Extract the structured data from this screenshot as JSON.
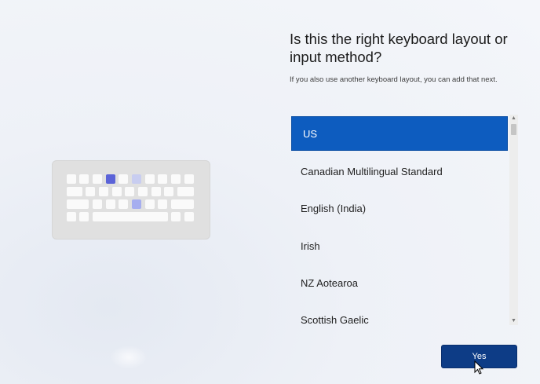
{
  "page": {
    "title": "Is this the right keyboard layout or input method?",
    "subtitle": "If you also use another keyboard layout, you can add that next."
  },
  "layouts": {
    "items": [
      {
        "label": "US",
        "selected": true
      },
      {
        "label": "Canadian Multilingual Standard",
        "selected": false
      },
      {
        "label": "English (India)",
        "selected": false
      },
      {
        "label": "Irish",
        "selected": false
      },
      {
        "label": "NZ Aotearoa",
        "selected": false
      },
      {
        "label": "Scottish Gaelic",
        "selected": false
      }
    ]
  },
  "actions": {
    "yes_label": "Yes"
  },
  "icons": {
    "illustration": "keyboard-illustration-icon",
    "scroll_up": "chevron-up-icon",
    "scroll_down": "chevron-down-icon",
    "cursor": "mouse-pointer-icon"
  },
  "colors": {
    "accent": "#0d5cbf",
    "button": "#0d3c86",
    "key_highlight": "#5b63d8"
  }
}
